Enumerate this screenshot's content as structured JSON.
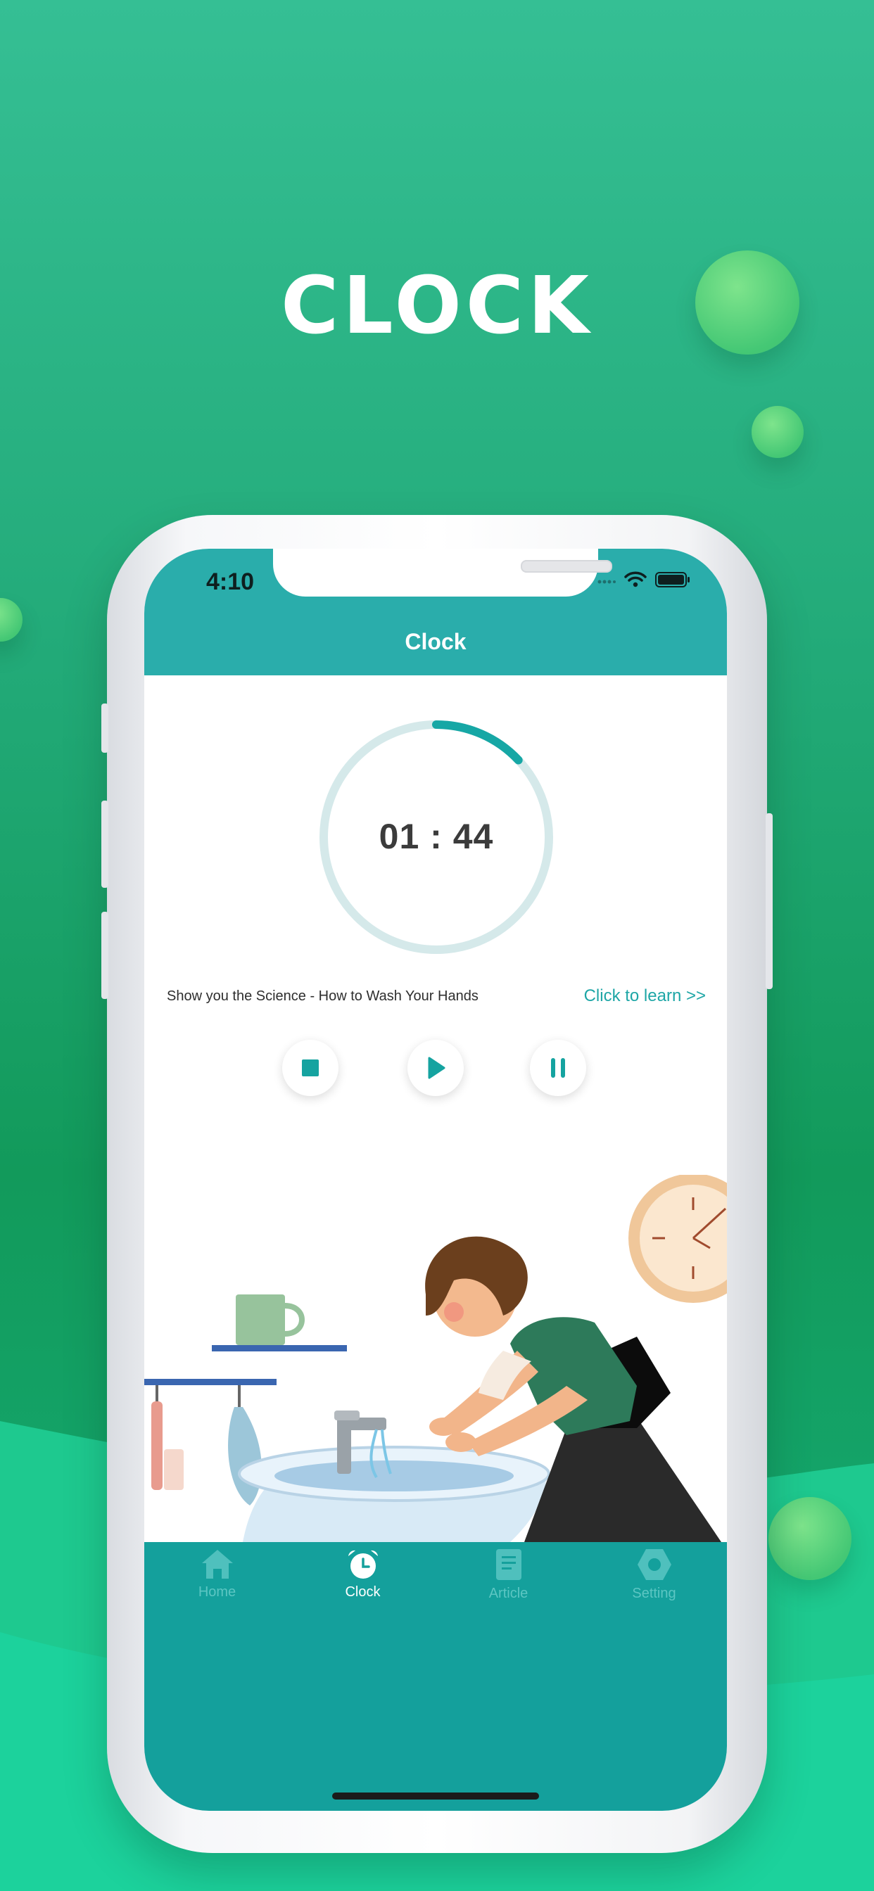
{
  "hero": {
    "title": "CLOCK"
  },
  "statusbar": {
    "time": "4:10"
  },
  "header": {
    "title": "Clock"
  },
  "timer": {
    "display": "01 : 44",
    "progress_fraction": 0.13
  },
  "info": {
    "description": "Show you the Science - How to Wash Your Hands",
    "learn_link": "Click to learn >>"
  },
  "controls": {
    "stop_icon": "stop-icon",
    "play_icon": "play-icon",
    "pause_icon": "pause-icon"
  },
  "tabs": [
    {
      "label": "Home",
      "icon": "home-icon",
      "active": false
    },
    {
      "label": "Clock",
      "icon": "alarm-clock-icon",
      "active": true
    },
    {
      "label": "Article",
      "icon": "book-icon",
      "active": false
    },
    {
      "label": "Setting",
      "icon": "hexagon-gear-icon",
      "active": false
    }
  ],
  "colors": {
    "accent": "#2aadab",
    "tabbar": "#14a09c",
    "background_top": "#35bf94",
    "background_bottom": "#16b07a",
    "ring_track": "#d5e9ea",
    "ring_progress": "#16a7a5"
  }
}
